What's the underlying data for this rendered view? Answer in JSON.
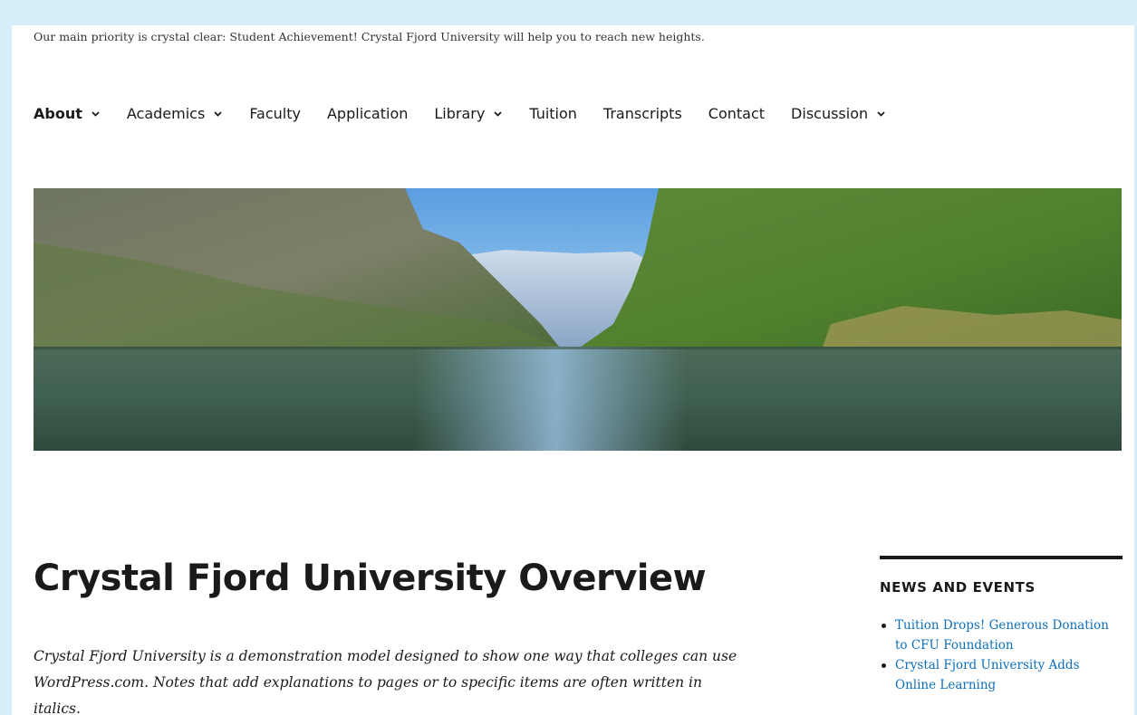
{
  "site": {
    "tagline": "Our main priority is crystal clear: Student Achievement! Crystal Fjord University will help you to reach new heights."
  },
  "nav": {
    "items": [
      {
        "label": "About",
        "has_dropdown": true,
        "active": true
      },
      {
        "label": "Academics",
        "has_dropdown": true,
        "active": false
      },
      {
        "label": "Faculty",
        "has_dropdown": false,
        "active": false
      },
      {
        "label": "Application",
        "has_dropdown": false,
        "active": false
      },
      {
        "label": "Library",
        "has_dropdown": true,
        "active": false
      },
      {
        "label": "Tuition",
        "has_dropdown": false,
        "active": false
      },
      {
        "label": "Transcripts",
        "has_dropdown": false,
        "active": false
      },
      {
        "label": "Contact",
        "has_dropdown": false,
        "active": false
      },
      {
        "label": "Discussion",
        "has_dropdown": true,
        "active": false
      }
    ]
  },
  "main": {
    "title": "Crystal Fjord University Overview",
    "intro": "Crystal Fjord University is a demonstration model designed to show one way that colleges can use WordPress.com. Notes that add explanations to pages or to specific items are often written in italics."
  },
  "sidebar": {
    "heading": "NEWS AND EVENTS",
    "news": [
      {
        "label": "Tuition Drops! Generous Donation to CFU Foundation"
      },
      {
        "label": "Crystal Fjord University Adds Online Learning"
      }
    ]
  },
  "colors": {
    "frame": "#d6eef9",
    "link": "#0d6fb8",
    "text": "#1a1a1a"
  },
  "icons": {
    "dropdown": "chevron-down-icon"
  }
}
